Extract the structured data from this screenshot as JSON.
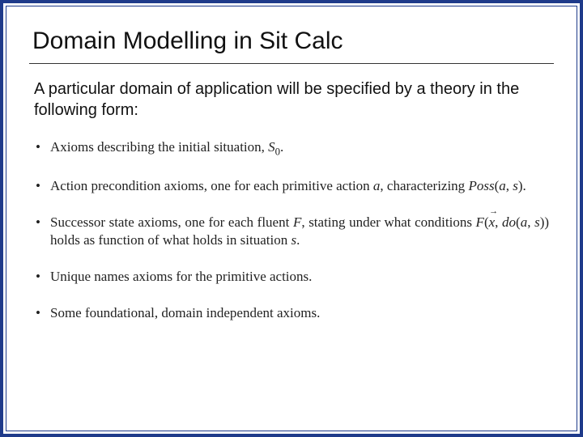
{
  "title": "Domain Modelling in Sit Calc",
  "intro": "A particular domain of application will be specified by a theory in the following form:",
  "bullets": {
    "b1_pre": "Axioms describing the initial situation, ",
    "b1_math": "S",
    "b1_sub": "0",
    "b1_post": ".",
    "b2_pre": "Action precondition axioms, one for each primitive action ",
    "b2_a": "a",
    "b2_mid": ", characterizing ",
    "b2_poss": "Poss",
    "b2_open": "(",
    "b2_a2": "a",
    "b2_comma": ", ",
    "b2_s": "s",
    "b2_close": ").",
    "b3_pre": "Successor state axioms, one for each fluent ",
    "b3_F": "F",
    "b3_mid": ", stating under what conditions ",
    "b3_F2": "F",
    "b3_open": "(",
    "b3_x": "x",
    "b3_c1": ", ",
    "b3_do": "do",
    "b3_open2": "(",
    "b3_a": "a",
    "b3_c2": ", ",
    "b3_s": "s",
    "b3_close2": "))",
    "b3_post": " holds as function of what holds in situation ",
    "b3_s2": "s",
    "b3_end": ".",
    "b4": "Unique names axioms for the primitive actions.",
    "b5": "Some foundational, domain independent axioms."
  }
}
